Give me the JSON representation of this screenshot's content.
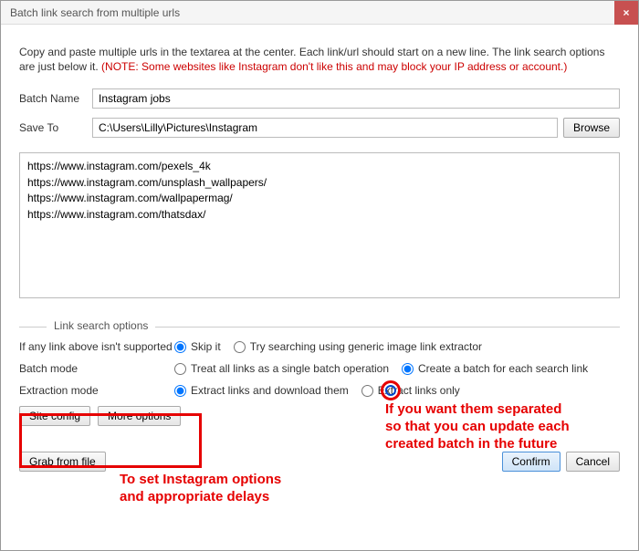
{
  "titlebar": {
    "title": "Batch link search from multiple urls",
    "close_glyph": "×"
  },
  "instructions": {
    "text": "Copy and paste multiple urls in the textarea at the center. Each link/url should start on a new line. The link search options are just below it. ",
    "note": "(NOTE: Some websites like Instagram don't like this and may block your IP address or account.)"
  },
  "batch_name": {
    "label": "Batch Name",
    "value": "Instagram jobs"
  },
  "save_to": {
    "label": "Save To",
    "value": "C:\\Users\\Lilly\\Pictures\\Instagram",
    "browse_label": "Browse"
  },
  "urls": "https://www.instagram.com/pexels_4k\nhttps://www.instagram.com/unsplash_wallpapers/\nhttps://www.instagram.com/wallpapermag/\nhttps://www.instagram.com/thatsdax/",
  "options_legend": "Link search options",
  "opt1": {
    "label": "If any link above isn't supported",
    "r1": "Skip it",
    "r2": "Try searching using generic image link extractor"
  },
  "opt2": {
    "label": "Batch mode",
    "r1": "Treat all links as a single batch operation",
    "r2": "Create a batch for each search link"
  },
  "opt3": {
    "label": "Extraction mode",
    "r1": "Extract links and download them",
    "r2": "Extract links only"
  },
  "buttons": {
    "site_config": "Site config",
    "more_options": "More options",
    "grab_from_file": "Grab from file",
    "confirm": "Confirm",
    "cancel": "Cancel"
  },
  "annotations": {
    "text1_l1": "If you want them separated",
    "text1_l2": "so that you can update each",
    "text1_l3": "created batch in the future",
    "text2_l1": "To set Instagram options",
    "text2_l2": "and appropriate delays"
  }
}
